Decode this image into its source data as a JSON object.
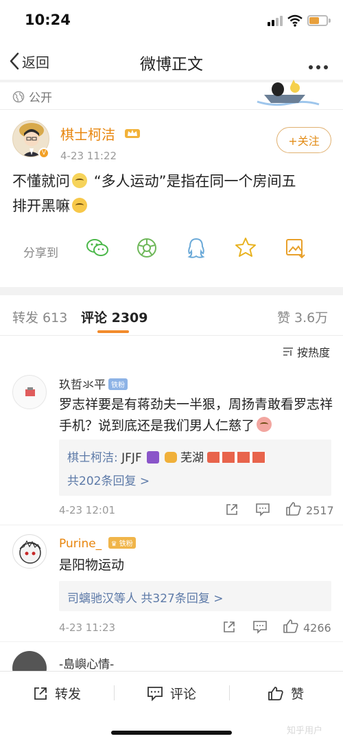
{
  "status_bar": {
    "time": "10:24",
    "battery_color": "#e8a03c"
  },
  "nav": {
    "back_label": "返回",
    "title": "微博正文"
  },
  "post": {
    "visibility": "公开",
    "author": "棋士柯洁",
    "time": "4-23 11:22",
    "follow_label": "+关注",
    "text_parts": [
      "不懂就问",
      "“多人运动”是指在同一个房间五",
      "排开黑嘛"
    ],
    "share_label": "分享到"
  },
  "tabs": {
    "repost": "转发 613",
    "comment": "评论 2309",
    "like": "赞 3.6万"
  },
  "sort_label": "按热度",
  "comments": [
    {
      "name": "玖哲氺平",
      "badge": "铁粉",
      "text": "罗志祥要是有蒋劲夫一半狠，周扬青敢看罗志祥手机？说到底还是我们男人仁慈了",
      "reply_author": "棋士柯洁:",
      "reply_text": "JFJF",
      "reply_extra": "芜湖",
      "reply_count": "共202条回复 >",
      "time": "4-23 12:01",
      "likes": "2517"
    },
    {
      "name": "Purine_",
      "badge": "铁粉",
      "text": "是阳物运动",
      "reply_summary": "司螭驰汉等人",
      "reply_count": "共327条回复 >",
      "time": "4-23 11:23",
      "likes": "4266"
    },
    {
      "name": "-島嶼心情-"
    }
  ],
  "bottom_bar": {
    "repost": "转发",
    "comment": "评论",
    "like": "赞"
  },
  "watermark": "知乎用户",
  "accent_color": "#f28b2c",
  "link_color": "#5d7aa8"
}
